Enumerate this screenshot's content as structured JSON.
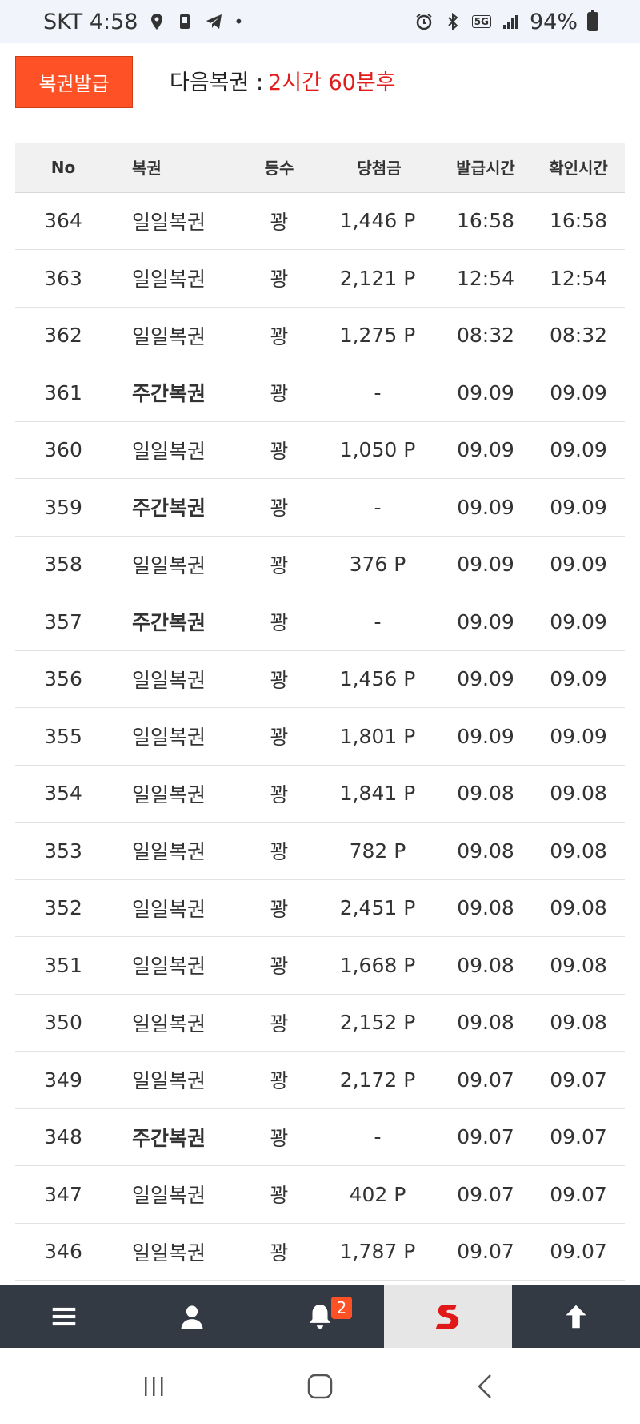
{
  "status_bar": {
    "carrier_time": "SKT 4:58",
    "network_tag": "5G",
    "battery": "94%"
  },
  "header": {
    "issue_button": "복권발급",
    "next_label": "다음복권 :",
    "next_value": "2시간 60분후"
  },
  "table": {
    "columns": [
      "No",
      "복권",
      "등수",
      "당첨금",
      "발급시간",
      "확인시간"
    ],
    "rows": [
      {
        "no": "364",
        "name": "일일복권",
        "rank": "꽝",
        "prize": "1,446 P",
        "issued": "16:58",
        "checked": "16:58",
        "bold": false
      },
      {
        "no": "363",
        "name": "일일복권",
        "rank": "꽝",
        "prize": "2,121 P",
        "issued": "12:54",
        "checked": "12:54",
        "bold": false
      },
      {
        "no": "362",
        "name": "일일복권",
        "rank": "꽝",
        "prize": "1,275 P",
        "issued": "08:32",
        "checked": "08:32",
        "bold": false
      },
      {
        "no": "361",
        "name": "주간복권",
        "rank": "꽝",
        "prize": "-",
        "issued": "09.09",
        "checked": "09.09",
        "bold": true
      },
      {
        "no": "360",
        "name": "일일복권",
        "rank": "꽝",
        "prize": "1,050 P",
        "issued": "09.09",
        "checked": "09.09",
        "bold": false
      },
      {
        "no": "359",
        "name": "주간복권",
        "rank": "꽝",
        "prize": "-",
        "issued": "09.09",
        "checked": "09.09",
        "bold": true
      },
      {
        "no": "358",
        "name": "일일복권",
        "rank": "꽝",
        "prize": "376 P",
        "issued": "09.09",
        "checked": "09.09",
        "bold": false
      },
      {
        "no": "357",
        "name": "주간복권",
        "rank": "꽝",
        "prize": "-",
        "issued": "09.09",
        "checked": "09.09",
        "bold": true
      },
      {
        "no": "356",
        "name": "일일복권",
        "rank": "꽝",
        "prize": "1,456 P",
        "issued": "09.09",
        "checked": "09.09",
        "bold": false
      },
      {
        "no": "355",
        "name": "일일복권",
        "rank": "꽝",
        "prize": "1,801 P",
        "issued": "09.09",
        "checked": "09.09",
        "bold": false
      },
      {
        "no": "354",
        "name": "일일복권",
        "rank": "꽝",
        "prize": "1,841 P",
        "issued": "09.08",
        "checked": "09.08",
        "bold": false
      },
      {
        "no": "353",
        "name": "일일복권",
        "rank": "꽝",
        "prize": "782 P",
        "issued": "09.08",
        "checked": "09.08",
        "bold": false
      },
      {
        "no": "352",
        "name": "일일복권",
        "rank": "꽝",
        "prize": "2,451 P",
        "issued": "09.08",
        "checked": "09.08",
        "bold": false
      },
      {
        "no": "351",
        "name": "일일복권",
        "rank": "꽝",
        "prize": "1,668 P",
        "issued": "09.08",
        "checked": "09.08",
        "bold": false
      },
      {
        "no": "350",
        "name": "일일복권",
        "rank": "꽝",
        "prize": "2,152 P",
        "issued": "09.08",
        "checked": "09.08",
        "bold": false
      },
      {
        "no": "349",
        "name": "일일복권",
        "rank": "꽝",
        "prize": "2,172 P",
        "issued": "09.07",
        "checked": "09.07",
        "bold": false
      },
      {
        "no": "348",
        "name": "주간복권",
        "rank": "꽝",
        "prize": "-",
        "issued": "09.07",
        "checked": "09.07",
        "bold": true
      },
      {
        "no": "347",
        "name": "일일복권",
        "rank": "꽝",
        "prize": "402 P",
        "issued": "09.07",
        "checked": "09.07",
        "bold": false
      },
      {
        "no": "346",
        "name": "일일복권",
        "rank": "꽝",
        "prize": "1,787 P",
        "issued": "09.07",
        "checked": "09.07",
        "bold": false
      }
    ]
  },
  "bottom_nav": {
    "items": [
      {
        "icon": "menu-icon"
      },
      {
        "icon": "user-icon"
      },
      {
        "icon": "bell-icon",
        "badge": "2"
      },
      {
        "icon": "logo-s-icon"
      },
      {
        "icon": "arrow-up-icon"
      }
    ]
  },
  "colors": {
    "accent": "#ff5126",
    "next_value": "#e11c1c",
    "nav_bg": "#343a44",
    "logo_red": "#e01818"
  }
}
